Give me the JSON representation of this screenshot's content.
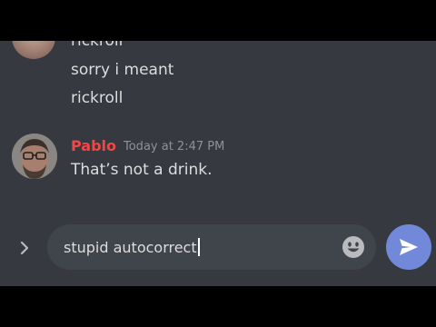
{
  "messages": {
    "previous": {
      "lines": [
        "rickroll",
        "sorry i meant",
        "rickroll"
      ]
    },
    "pablo": {
      "author": "Pablo",
      "timestamp": "Today at 2:47 PM",
      "text": "That’s not a drink."
    }
  },
  "composer": {
    "value": "stupid autocorrect"
  },
  "icons": {
    "expand": "chevron-right-icon",
    "emoji": "smiley-icon",
    "send": "paper-plane-icon"
  },
  "colors": {
    "background": "#36393f",
    "input": "#40444b",
    "author": "#f04747",
    "send": "#7289da"
  }
}
